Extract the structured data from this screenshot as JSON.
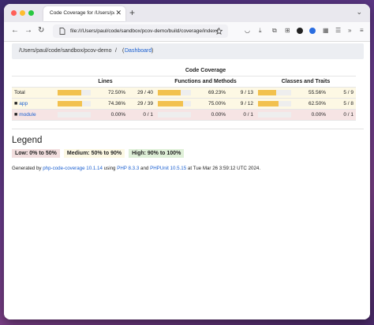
{
  "browser": {
    "tab_title": "Code Coverage for /Users/paul/code/sandbox/pcov-demo/build/coverage",
    "tab_close": "✕",
    "new_tab": "+",
    "tab_menu": "⌄",
    "url": "file:///Users/paul/code/sandbox/pcov-demo/build/coverage/index.html"
  },
  "breadcrumb": {
    "path": "/Users/paul/code/sandbox/pcov-demo",
    "separator": "/",
    "open": "(",
    "link": "Dashboard",
    "close": ")"
  },
  "table": {
    "group_header": "Code Coverage",
    "columns": [
      "Lines",
      "Functions and Methods",
      "Classes and Traits"
    ],
    "rows": [
      {
        "name": "Total",
        "status": "warning",
        "lines_pct": "72.50%",
        "lines_count": "29 / 40",
        "lines_fill": 72.5,
        "func_pct": "69.23%",
        "func_count": "9 / 13",
        "func_fill": 69.23,
        "cls_pct": "55.56%",
        "cls_count": "5 / 9",
        "cls_fill": 55.56
      },
      {
        "name": "app",
        "status": "warning",
        "lines_pct": "74.36%",
        "lines_count": "29 / 39",
        "lines_fill": 74.36,
        "func_pct": "75.00%",
        "func_count": "9 / 12",
        "func_fill": 75.0,
        "cls_pct": "62.50%",
        "cls_count": "5 / 8",
        "cls_fill": 62.5
      },
      {
        "name": "module",
        "status": "danger",
        "lines_pct": "0.00%",
        "lines_count": "0 / 1",
        "lines_fill": 0,
        "func_pct": "0.00%",
        "func_count": "0 / 1",
        "func_fill": 0,
        "cls_pct": "0.00%",
        "cls_count": "0 / 1",
        "cls_fill": 0
      }
    ]
  },
  "legend": {
    "title": "Legend",
    "low": "Low: 0% to 50%",
    "medium": "Medium: 50% to 90%",
    "high": "High: 90% to 100%"
  },
  "footer": {
    "generated_by": "Generated by",
    "coverage_link": "php-code-coverage 10.1.14",
    "using": "using",
    "php_link": "PHP 8.3.3",
    "and": "and",
    "phpunit_link": "PHPUnit 10.5.15",
    "at": "at Tue Mar 26 3:59:12 UTC 2024."
  },
  "colors": {
    "warning_row": "#fdf8e4",
    "danger_row": "#f6e4e4",
    "bar_fill": "#f2c14e",
    "low_badge": "#f2dede",
    "medium_badge": "#fcf8e3",
    "high_badge": "#dff0d8",
    "link": "#1a5fd0"
  }
}
